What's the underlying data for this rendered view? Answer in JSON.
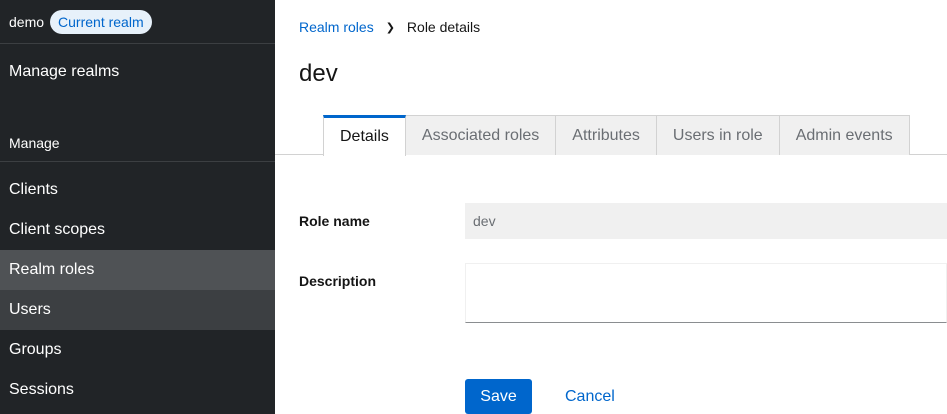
{
  "sidebar": {
    "realm_name": "demo",
    "realm_badge": "Current realm",
    "manage_realms": "Manage realms",
    "section_title": "Manage",
    "items": [
      {
        "label": "Clients"
      },
      {
        "label": "Client scopes"
      },
      {
        "label": "Realm roles"
      },
      {
        "label": "Users"
      },
      {
        "label": "Groups"
      },
      {
        "label": "Sessions"
      }
    ],
    "active_item": "Realm roles"
  },
  "breadcrumb": {
    "parent": "Realm roles",
    "separator": "❯",
    "current": "Role details"
  },
  "page": {
    "title": "dev"
  },
  "tabs": [
    {
      "label": "Details",
      "active": true
    },
    {
      "label": "Associated roles"
    },
    {
      "label": "Attributes"
    },
    {
      "label": "Users in role"
    },
    {
      "label": "Admin events"
    }
  ],
  "form": {
    "role_name_label": "Role name",
    "role_name_value": "dev",
    "description_label": "Description",
    "description_value": ""
  },
  "actions": {
    "save_label": "Save",
    "cancel_label": "Cancel"
  },
  "colors": {
    "sidebar_bg": "#212427",
    "accent": "#0066cc",
    "active_nav_bg": "#4f5255"
  }
}
